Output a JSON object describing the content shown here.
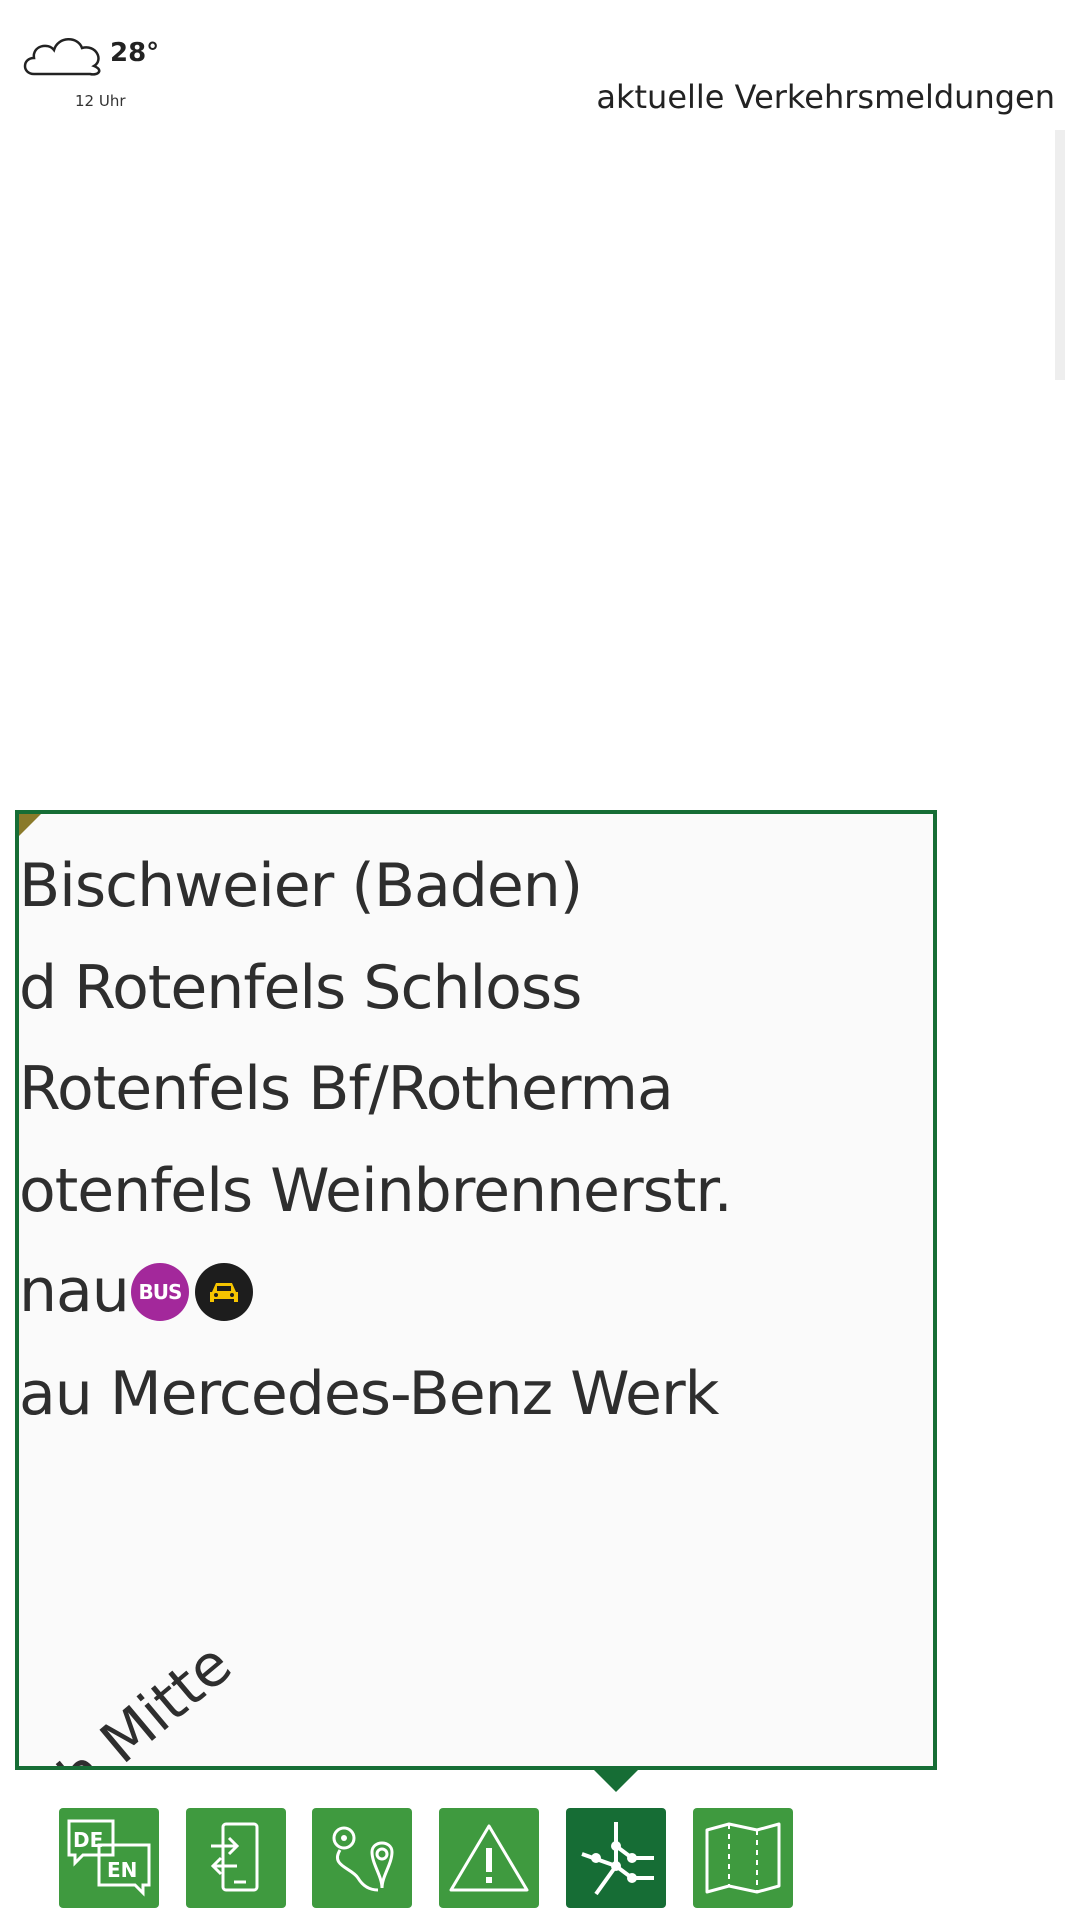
{
  "weather": {
    "temperature": "28°",
    "time": "12 Uhr",
    "icon": "cloud-icon"
  },
  "header": {
    "traffic_link": "aktuelle Verkehrsmeldungen"
  },
  "map": {
    "lines": [
      "          ",
      "Bischweier (Baden)",
      "d Rotenfels Schloss",
      "Rotenfels Bf/Rotherma",
      "otenfels Weinbrennerstr.",
      "nau",
      "au Mercedes-Benz Werk"
    ],
    "bus_badge": "BUS",
    "diagonal": [
      "ch",
      "h Mitte"
    ]
  },
  "nav": {
    "items": [
      {
        "name": "language",
        "icon": "language-de-en-icon",
        "de": "DE",
        "en": "EN"
      },
      {
        "name": "mobile-ticket",
        "icon": "phone-login-icon"
      },
      {
        "name": "route",
        "icon": "route-pin-icon"
      },
      {
        "name": "alerts",
        "icon": "warning-icon"
      },
      {
        "name": "network",
        "icon": "network-map-icon",
        "active": true
      },
      {
        "name": "map",
        "icon": "folded-map-icon"
      }
    ]
  },
  "colors": {
    "accent_dark": "#166d35",
    "accent": "#3f9a3f",
    "bus": "#a3289b",
    "taxi": "#1d1d1d"
  }
}
